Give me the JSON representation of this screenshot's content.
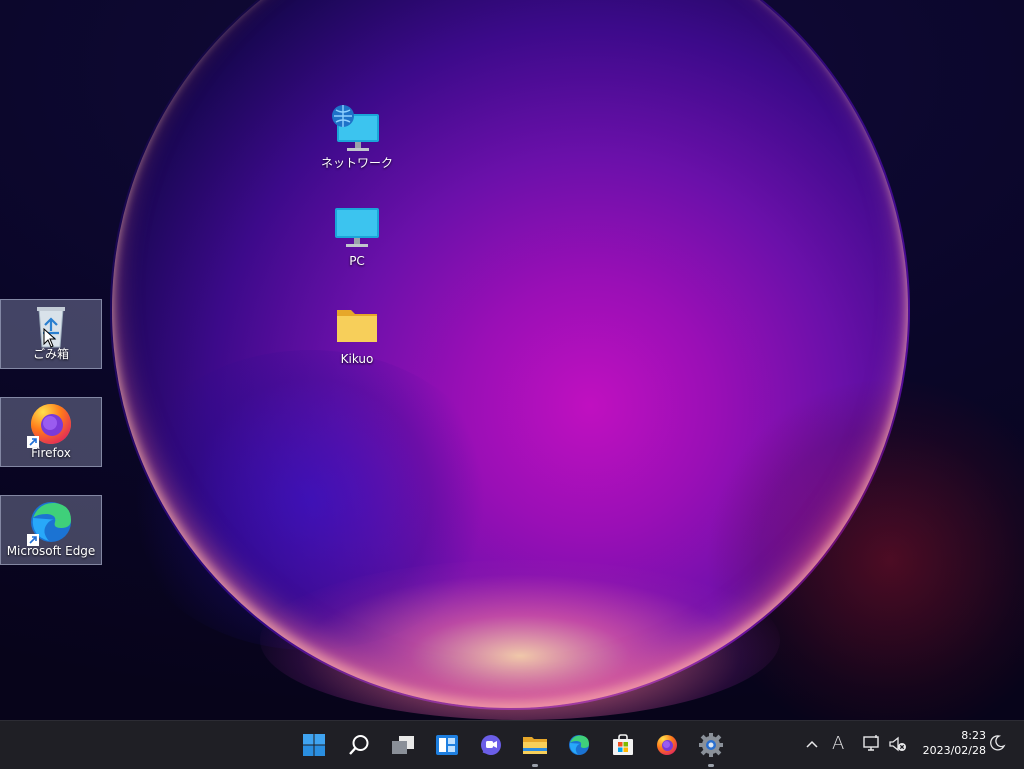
{
  "desktop": {
    "icons": [
      {
        "label": "ネットワーク",
        "icon": "network-icon"
      },
      {
        "label": "PC",
        "icon": "pc-icon"
      },
      {
        "label": "Kikuo",
        "icon": "folder-icon"
      },
      {
        "label": "ごみ箱",
        "icon": "recycle-bin-icon"
      },
      {
        "label": "Firefox",
        "icon": "firefox-icon"
      },
      {
        "label": "Microsoft Edge",
        "icon": "edge-icon"
      }
    ]
  },
  "taskbar": {
    "pinned": [
      {
        "name": "start",
        "icon": "windows-logo-icon"
      },
      {
        "name": "search",
        "icon": "search-icon"
      },
      {
        "name": "task-view",
        "icon": "task-view-icon"
      },
      {
        "name": "widgets",
        "icon": "widgets-icon"
      },
      {
        "name": "chat",
        "icon": "teams-chat-icon"
      },
      {
        "name": "file-explorer",
        "icon": "file-explorer-icon"
      },
      {
        "name": "edge",
        "icon": "edge-icon"
      },
      {
        "name": "store",
        "icon": "store-icon"
      },
      {
        "name": "firefox",
        "icon": "firefox-icon"
      },
      {
        "name": "settings",
        "icon": "gear-icon"
      }
    ],
    "tray": {
      "ime": "A",
      "time": "8:23",
      "date": "2023/02/28"
    }
  },
  "colors": {
    "accent": "#0078d4",
    "taskbar_bg": "#1f1f25",
    "folder": "#f5c542"
  }
}
